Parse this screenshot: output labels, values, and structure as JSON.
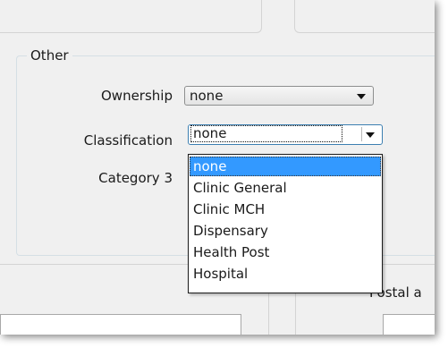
{
  "group": {
    "title": "Other"
  },
  "fields": {
    "ownership": {
      "label": "Ownership",
      "value": "none"
    },
    "classification": {
      "label": "Classification",
      "value": "none"
    },
    "category3": {
      "label": "Category 3"
    }
  },
  "dropdown": {
    "options": [
      "none",
      "Clinic General",
      "Clinic MCH",
      "Dispensary",
      "Health Post",
      "Hospital"
    ],
    "selected": "none"
  },
  "postal_label": "Postal a",
  "colors": {
    "selection": "#3399ff",
    "window_bg": "#f0f0f0",
    "focus_border": "#3c7fb1"
  }
}
